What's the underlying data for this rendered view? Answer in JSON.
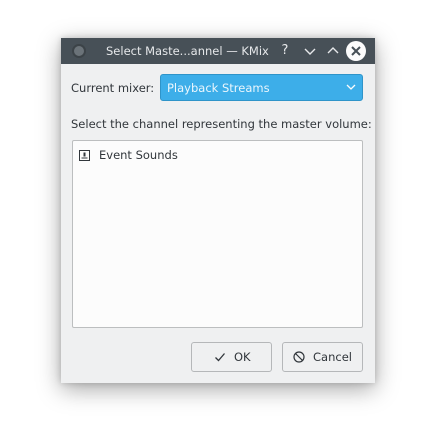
{
  "window": {
    "title": "Select Maste...annel — KMix",
    "help_label": "?",
    "min_label": "⌄",
    "max_label": "⌃"
  },
  "mixer": {
    "label": "Current mixer:",
    "selected": "Playback Streams"
  },
  "channels": {
    "prompt": "Select the channel representing the master volume:",
    "items": [
      {
        "label": "Event Sounds"
      }
    ]
  },
  "buttons": {
    "ok_label": "OK",
    "cancel_label": "Cancel"
  },
  "colors": {
    "titlebar": "#475057",
    "accent": "#3daee9",
    "window_bg": "#eff0f1"
  }
}
